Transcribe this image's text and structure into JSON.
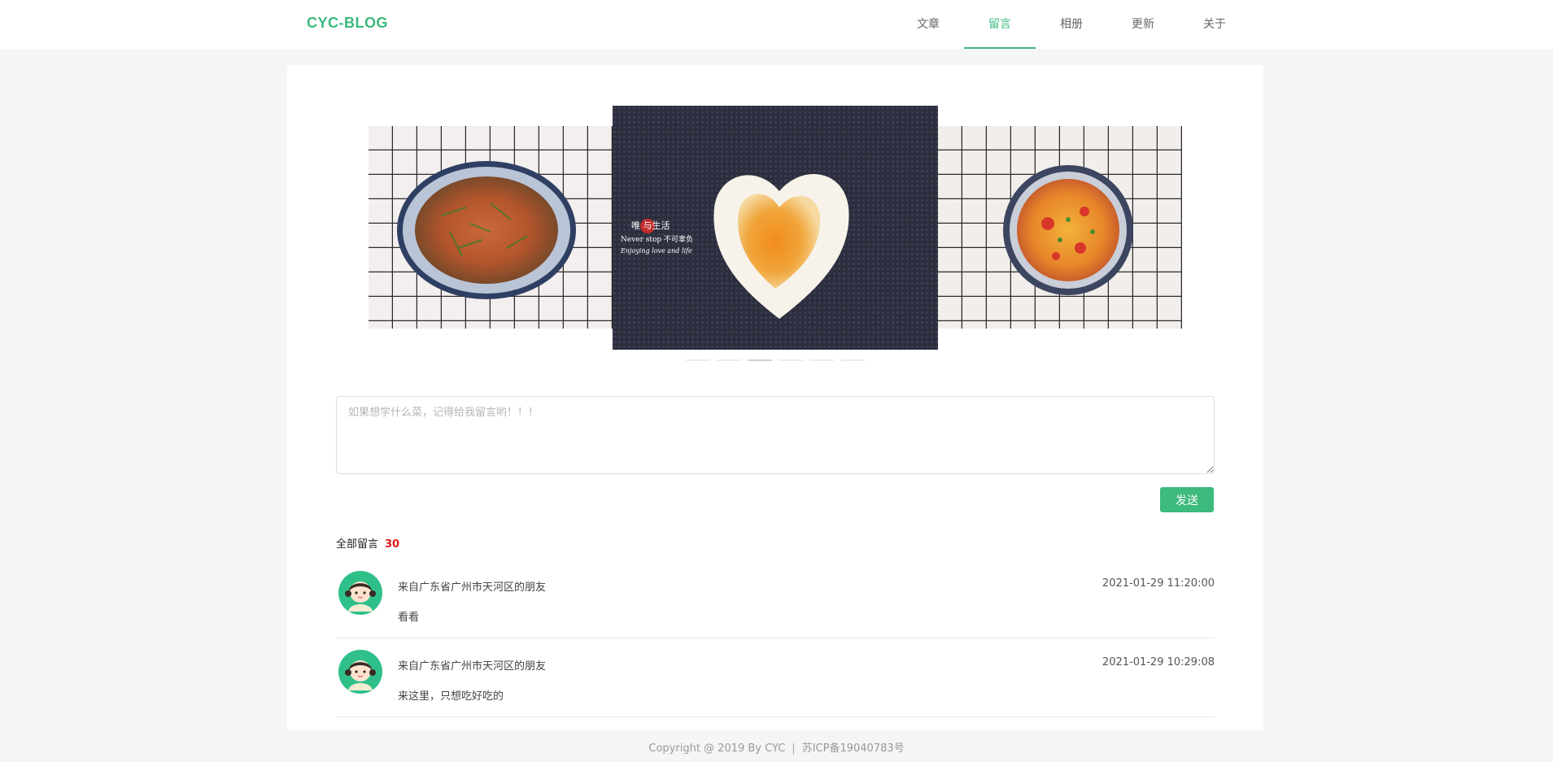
{
  "header": {
    "logo": "CYC-BLOG",
    "nav": [
      {
        "label": "文章",
        "active": false
      },
      {
        "label": "留言",
        "active": true
      },
      {
        "label": "相册",
        "active": false
      },
      {
        "label": "更新",
        "active": false
      },
      {
        "label": "关于",
        "active": false
      }
    ],
    "accent_color": "#3dba7d"
  },
  "carousel": {
    "slides": [
      "shrimp-dish-image",
      "heart-fried-egg-image",
      "tomato-egg-soup-image"
    ],
    "center_caption": {
      "line1": "唯  与生活",
      "line2": "Never stop 不可辜负",
      "line3": "Enjoying love and life"
    },
    "dot_count": 6,
    "active_dot": 3
  },
  "message": {
    "placeholder": "如果想学什么菜，记得给我留言哟！！！",
    "value": "",
    "send_label": "发送"
  },
  "comments_header": {
    "label": "全部留言",
    "count": "30"
  },
  "comments": [
    {
      "from": "来自广东省广州市天河区的朋友",
      "time": "2021-01-29 11:20:00",
      "text": "看看"
    },
    {
      "from": "来自广东省广州市天河区的朋友",
      "time": "2021-01-29 10:29:08",
      "text": "来这里，只想吃好吃的"
    }
  ],
  "footer": {
    "copyright": "Copyright @ 2019 By CYC",
    "separator": "|",
    "icp": "苏ICP备19040783号"
  }
}
